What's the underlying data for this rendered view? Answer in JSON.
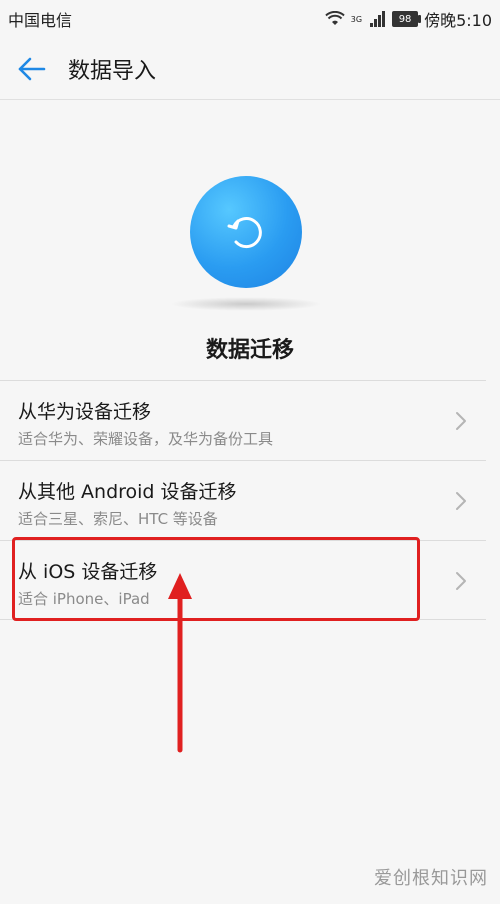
{
  "status_bar": {
    "carrier": "中国电信",
    "network": "3G",
    "battery": "98",
    "time": "傍晚5:10"
  },
  "header": {
    "title": "数据导入"
  },
  "hero": {
    "title": "数据迁移",
    "icon": "sync-icon",
    "accent": "#2a9cf1"
  },
  "options": [
    {
      "title": "从华为设备迁移",
      "subtitle": "适合华为、荣耀设备，及华为备份工具"
    },
    {
      "title": "从其他 Android 设备迁移",
      "subtitle": "适合三星、索尼、HTC 等设备"
    },
    {
      "title": "从 iOS 设备迁移",
      "subtitle": "适合 iPhone、iPad"
    }
  ],
  "annotation": {
    "color": "#e02020"
  },
  "watermark": "爱创根知识网"
}
